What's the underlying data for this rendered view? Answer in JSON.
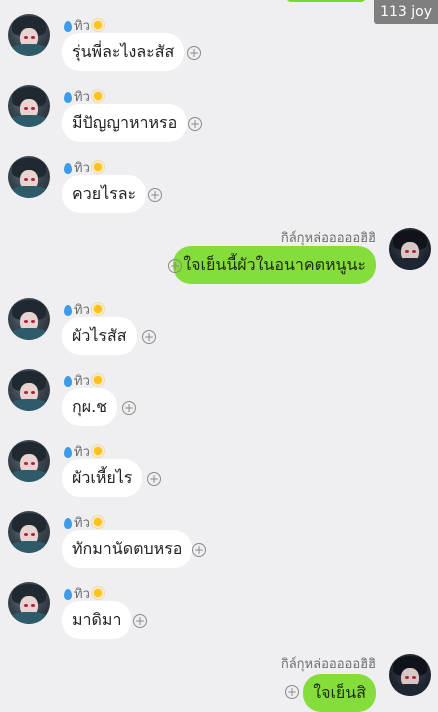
{
  "watermark": "113 joy",
  "incoming_sender": "ทิว",
  "outgoing_sender": "กิล์กุหล่อออออฮิฮิ",
  "messages": [
    {
      "dir": "in",
      "text": "รุ่นพี่ละไงละสัส"
    },
    {
      "dir": "in",
      "text": "มีปัญญาหาหรอ"
    },
    {
      "dir": "in",
      "text": "ควยไรละ"
    },
    {
      "dir": "out",
      "text": "ใจเย็นนี้ผัวในอนาคตหนูนะ"
    },
    {
      "dir": "in",
      "text": "ผัวไรสัส"
    },
    {
      "dir": "in",
      "text": "กุผ.ช"
    },
    {
      "dir": "in",
      "text": "ผัวเหี้ยไร"
    },
    {
      "dir": "in",
      "text": "ทักมานัดตบหรอ"
    },
    {
      "dir": "in",
      "text": "มาดิมา"
    },
    {
      "dir": "out",
      "text": "ใจเย็นสิ"
    }
  ],
  "icons": {
    "drop": "water-drop-icon",
    "sun": "sun-icon",
    "add": "plus-circle-icon"
  },
  "colors": {
    "background": "#efeff1",
    "outgoing_bubble": "#85dd3c",
    "incoming_bubble": "#ffffff"
  }
}
